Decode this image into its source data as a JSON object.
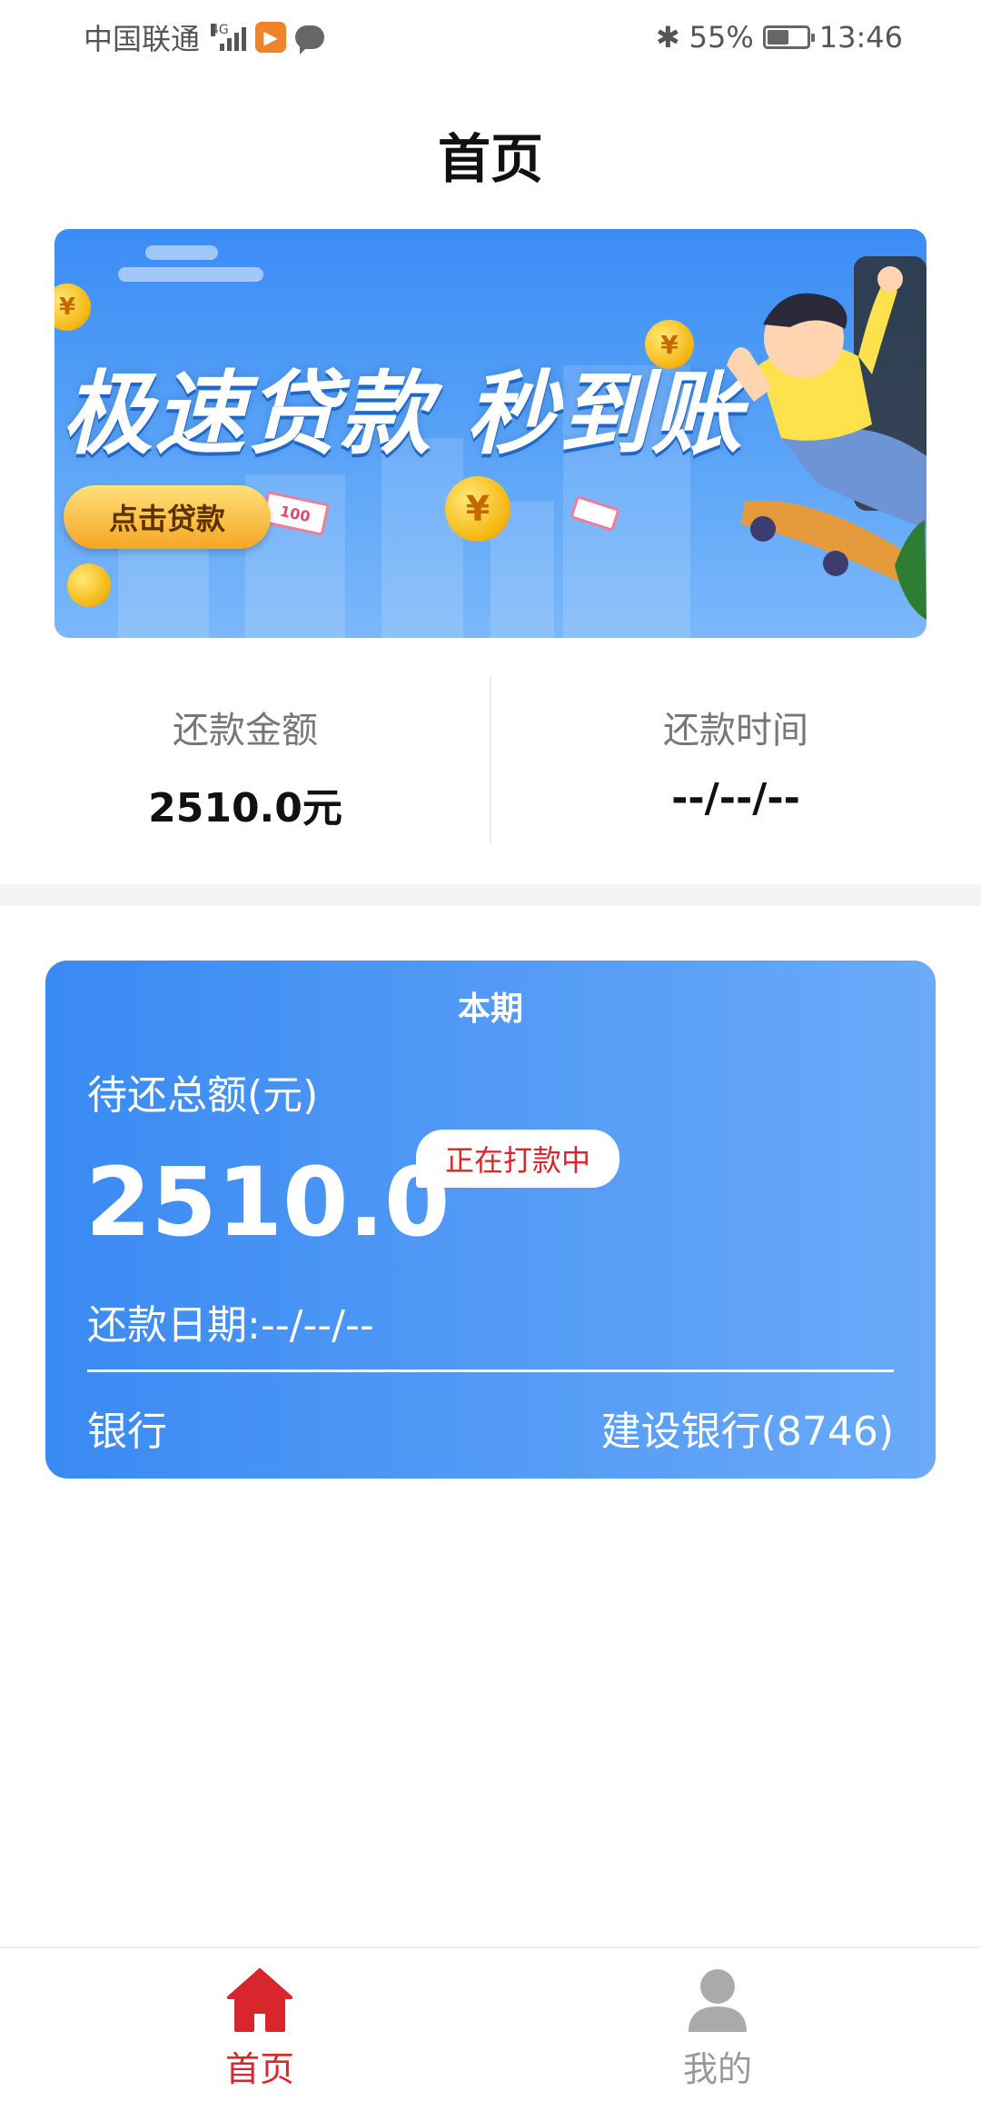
{
  "status_bar": {
    "carrier": "中国联通",
    "network": "4G",
    "bluetooth": "✱",
    "battery": "55%",
    "time": "13:46"
  },
  "page": {
    "title": "首页"
  },
  "banner": {
    "headline": "极速贷款 秒到账",
    "cta": "点击贷款",
    "coin_symbol": "¥",
    "bill_value": "100"
  },
  "summary": {
    "amount_label": "还款金额",
    "amount_value": "2510.0元",
    "time_label": "还款时间",
    "time_value": "--/--/--"
  },
  "current_period": {
    "title": "本期",
    "total_label": "待还总额(元)",
    "total_amount": "2510.0",
    "status": "正在打款中",
    "due_date": "还款日期:--/--/--",
    "bank_label": "银行",
    "bank_value": "建设银行(8746)"
  },
  "tabs": [
    {
      "label": "首页",
      "icon": "home-icon",
      "active": true
    },
    {
      "label": "我的",
      "icon": "user-icon",
      "active": false
    }
  ],
  "colors": {
    "accent_red": "#d9252c",
    "card_blue_start": "#3a8af3",
    "card_blue_end": "#6aaaf8",
    "inactive_gray": "#999999"
  }
}
